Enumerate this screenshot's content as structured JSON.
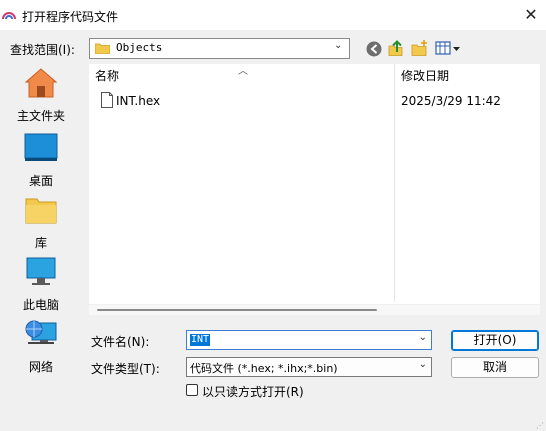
{
  "window": {
    "title": "打开程序代码文件",
    "close_glyph": "✕"
  },
  "look_in": {
    "label": "查找范围(I):",
    "value": "Objects"
  },
  "places": [
    {
      "label": "主文件夹",
      "icon": "home-icon"
    },
    {
      "label": "桌面",
      "icon": "desktop-icon"
    },
    {
      "label": "库",
      "icon": "library-folder-icon"
    },
    {
      "label": "此电脑",
      "icon": "computer-icon"
    },
    {
      "label": "网络",
      "icon": "network-icon"
    }
  ],
  "file_list": {
    "columns": [
      "名称",
      "修改日期"
    ],
    "files": [
      {
        "name": "INT.hex",
        "modified": "2025/3/29 11:42"
      }
    ]
  },
  "form": {
    "filename_label": "文件名(N):",
    "filename_value": "INT",
    "filetype_label": "文件类型(T):",
    "filetype_value": "代码文件 (*.hex;  *.ihx;*.bin)",
    "readonly_label": "以只读方式打开(R)"
  },
  "buttons": {
    "open": "打开(O)",
    "cancel": "取消"
  },
  "colors": {
    "accent": "#0078d7",
    "folder": "#f2c94c"
  }
}
